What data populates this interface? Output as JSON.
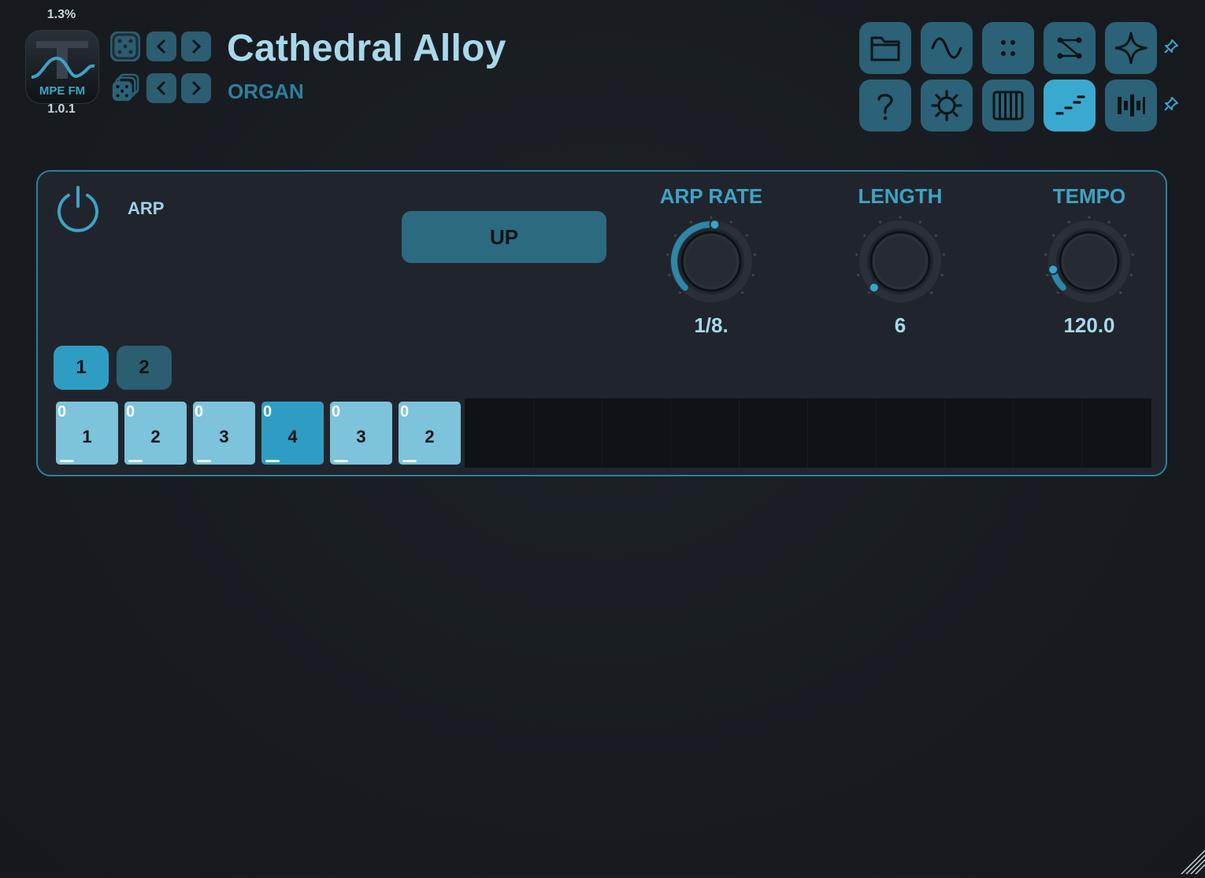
{
  "header": {
    "cpu": "1.3%",
    "logo_text": "MPE FM",
    "version": "1.0.1",
    "preset_name": "Cathedral Alloy",
    "category": "ORGAN"
  },
  "toolbar": {
    "row1": [
      "folder-icon",
      "sine-wave-icon",
      "dots-grid-icon",
      "routing-icon",
      "sparkle-icon"
    ],
    "row2": [
      "help-icon",
      "settings-icon",
      "keyboard-icon",
      "arpeggiator-icon",
      "bars-icon"
    ],
    "active": "arpeggiator-icon"
  },
  "arp": {
    "label": "ARP",
    "mode": "UP",
    "knobs": [
      {
        "title": "ARP RATE",
        "value": "1/8.",
        "level": 0.52
      },
      {
        "title": "LENGTH",
        "value": "6",
        "level": 0.0
      },
      {
        "title": "TEMPO",
        "value": "120.0",
        "level": 0.12
      }
    ],
    "pages": [
      "1",
      "2"
    ],
    "active_page": "1",
    "steps": [
      {
        "offset": "0",
        "note": "1",
        "highlight": false
      },
      {
        "offset": "0",
        "note": "2",
        "highlight": false
      },
      {
        "offset": "0",
        "note": "3",
        "highlight": false
      },
      {
        "offset": "0",
        "note": "4",
        "highlight": true
      },
      {
        "offset": "0",
        "note": "3",
        "highlight": false
      },
      {
        "offset": "0",
        "note": "2",
        "highlight": false
      }
    ]
  },
  "colors": {
    "accent": "#3ea3c4",
    "button": "#2b6277",
    "active": "#3aa9cf",
    "step": "#7cc3db",
    "step_highlight": "#2f9dc3"
  }
}
